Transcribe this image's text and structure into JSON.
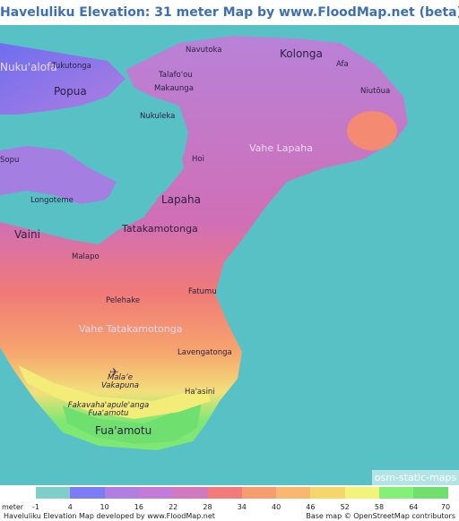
{
  "title": "Haveluliku Elevation: 31 meter Map by www.FloodMap.net (beta)",
  "map": {
    "places": [
      {
        "name": "Navutoka",
        "size": "sm"
      },
      {
        "name": "Kolonga",
        "size": "lg"
      },
      {
        "name": "Afa",
        "size": "sm"
      },
      {
        "name": "Niutōua",
        "size": "sm"
      },
      {
        "name": "Talafo'ou",
        "size": "sm"
      },
      {
        "name": "Makaunga",
        "size": "sm"
      },
      {
        "name": "Nukuleka",
        "size": "sm"
      },
      {
        "name": "Nuku'alofa",
        "size": "lg"
      },
      {
        "name": "Tukutonga",
        "size": "sm"
      },
      {
        "name": "Popua",
        "size": "lg"
      },
      {
        "name": "Vahe Lapaha",
        "size": "md"
      },
      {
        "name": "Hoi",
        "size": "sm"
      },
      {
        "name": "Sopu",
        "size": "sm"
      },
      {
        "name": "Longoteme",
        "size": "sm"
      },
      {
        "name": "Lapaha",
        "size": "lg"
      },
      {
        "name": "Vaini",
        "size": "lg"
      },
      {
        "name": "Tatakamotonga",
        "size": "md"
      },
      {
        "name": "Malapo",
        "size": "sm"
      },
      {
        "name": "Fatumu",
        "size": "sm"
      },
      {
        "name": "Pelehake",
        "size": "sm"
      },
      {
        "name": "Vahe Tatakamotonga",
        "size": "md"
      },
      {
        "name": "Lavengatonga",
        "size": "sm"
      },
      {
        "name": "Malaʻe Vakapuna",
        "size": "sm"
      },
      {
        "name": "Ha'asini",
        "size": "sm"
      },
      {
        "name": "Fakavaha'apule'anga Fua'amotu",
        "size": "sm"
      },
      {
        "name": "Fua'amotu",
        "size": "lg"
      }
    ],
    "badge": "osm-static-maps",
    "airport_icon": "airplane-icon"
  },
  "legend": {
    "unit": "meter",
    "ticks": [
      "-1",
      "4",
      "10",
      "16",
      "22",
      "28",
      "34",
      "40",
      "46",
      "52",
      "58",
      "64",
      "70"
    ],
    "colors": [
      "#7dcfc8",
      "#7c7cf4",
      "#b07ee0",
      "#c47ad8",
      "#d278bc",
      "#f27a78",
      "#f69c70",
      "#f8b870",
      "#f6d66c",
      "#f2f37a",
      "#84f078",
      "#6fe070"
    ]
  },
  "footer": {
    "left": "Haveluliku Elevation Map developed by www.FloodMap.net",
    "right": "Base map © OpenStreetMap contributors"
  }
}
